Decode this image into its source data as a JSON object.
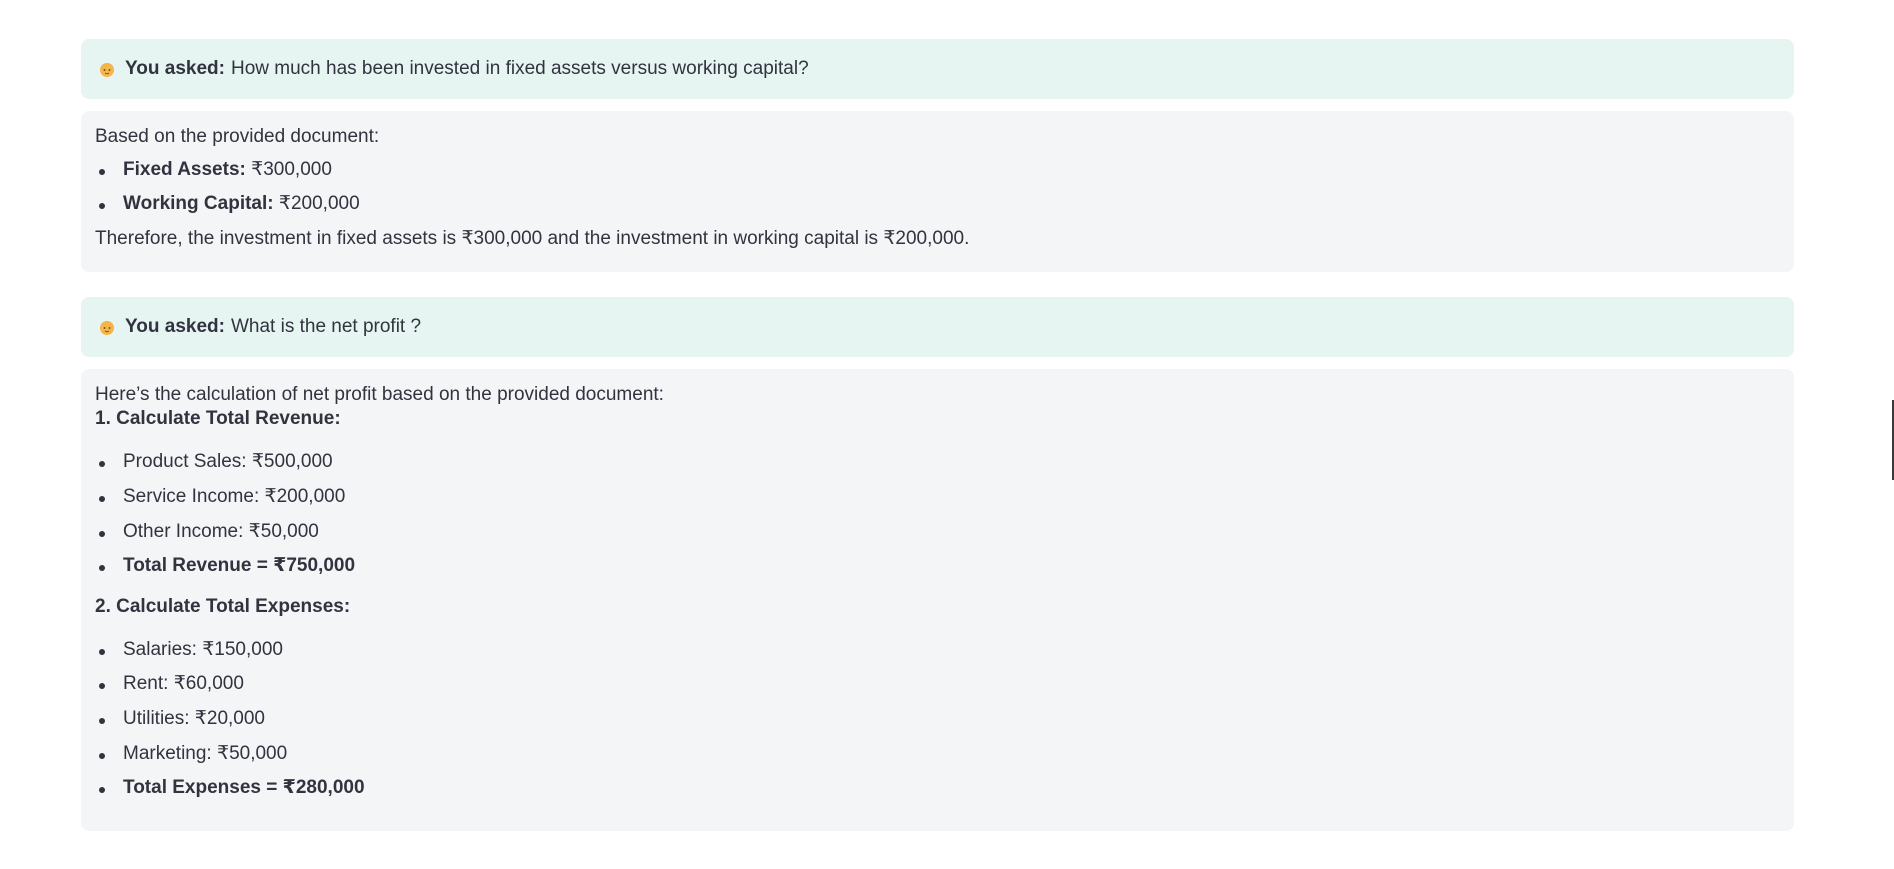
{
  "chat": {
    "prefix": "You asked:",
    "q1": "How much has been invested in fixed assets versus working capital?",
    "a1": {
      "intro": "Based on the provided document:",
      "items": [
        {
          "label": "Fixed Assets:",
          "value": "₹300,000"
        },
        {
          "label": "Working Capital:",
          "value": "₹200,000"
        }
      ],
      "conclusion": "Therefore, the investment in fixed assets is ₹300,000 and the investment in working capital is ₹200,000."
    },
    "q2": "What is the net profit ?",
    "a2": {
      "intro": "Here’s the calculation of net profit based on the provided document:",
      "step1": "1. Calculate Total Revenue:",
      "revenue_items": [
        "Product Sales: ₹500,000",
        "Service Income: ₹200,000",
        "Other Income: ₹50,000"
      ],
      "revenue_total_label": "Total Revenue",
      "revenue_total_value": "= ₹750,000",
      "step2": "2. Calculate Total Expenses:",
      "expense_items": [
        "Salaries: ₹150,000",
        "Rent: ₹60,000",
        "Utilities: ₹20,000",
        "Marketing: ₹50,000"
      ],
      "expense_total_label": "Total Expenses",
      "expense_total_value": "= ₹280,000"
    }
  },
  "icons": {
    "user_emoji": "person-emoji-icon"
  },
  "colors": {
    "question_bg": "#e6f5f2",
    "answer_bg": "#f4f5f7",
    "text": "#31333f"
  }
}
